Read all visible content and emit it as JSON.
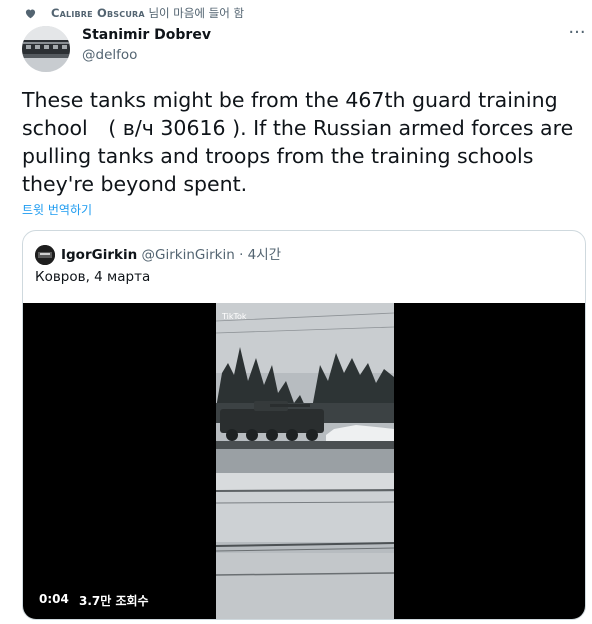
{
  "liked_by": {
    "name": "Calibre Obscura",
    "suffix": " 님이 마음에 들어 함"
  },
  "author": {
    "name": "Stanimir Dobrev",
    "handle": "@delfoo"
  },
  "more_label": "···",
  "tweet": {
    "text": "These tanks might be from the 467th guard training\nschool　( в/ч 30616 ). If the Russian armed forces are\npulling tanks and troops from the training schools\nthey're beyond spent.",
    "translate_label": "트윗 번역하기"
  },
  "quoted": {
    "name": "IgorGirkin",
    "handle": "@GirkinGirkin",
    "separator": " · ",
    "time": "4시간",
    "text": "Ковров, 4 марта",
    "video": {
      "watermark": "TikTok",
      "duration": "0:04",
      "views": "3.7만 조회수"
    }
  },
  "colors": {
    "accent": "#1d9bf0",
    "secondary_text": "#536471",
    "border": "#cfd9de"
  }
}
